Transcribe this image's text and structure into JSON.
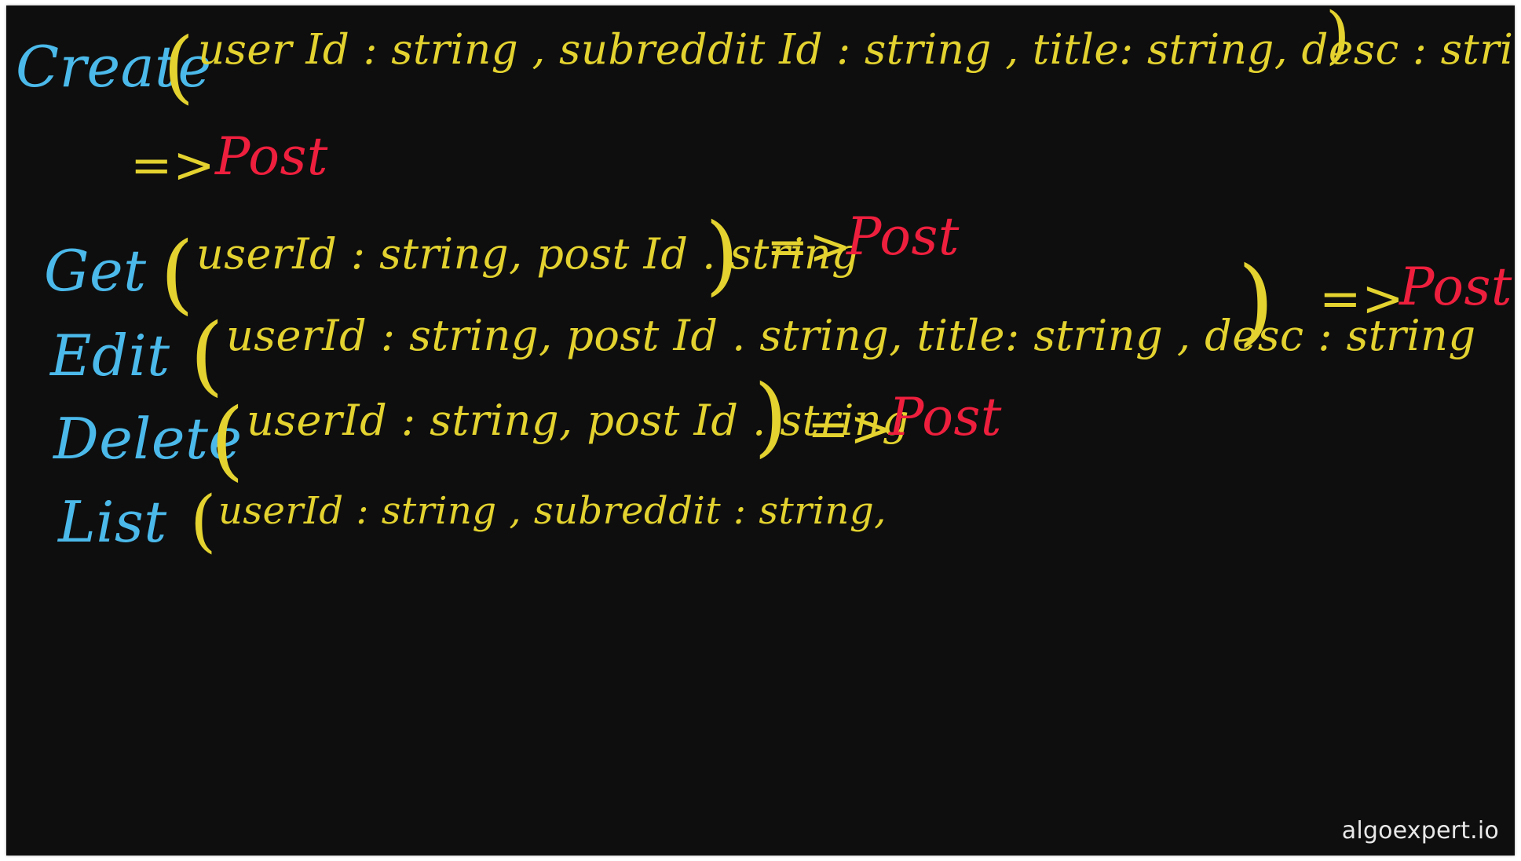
{
  "colors": {
    "background": "#0e0e0e",
    "keyword": "#4bb9ea",
    "args": "#e3d22f",
    "return": "#ee1f3d",
    "watermark": "#e8e8e8"
  },
  "lines": [
    {
      "keyword": "Create",
      "open": "(",
      "args": "user Id : string ,  subreddit Id : string , title: string, desc : string",
      "close": ")",
      "arrow": "=>",
      "returns": "Post"
    },
    {
      "keyword": "Get",
      "open": "(",
      "args": "userId : string, post Id . string",
      "close": ")",
      "arrow": "=>",
      "returns": "Post"
    },
    {
      "keyword": "Edit",
      "open": "(",
      "args": "userId : string, post Id . string, title: string ,  desc : string",
      "close": ")",
      "arrow": "=>",
      "returns": "Post"
    },
    {
      "keyword": "Delete",
      "open": "(",
      "args": "userId : string, post Id . string",
      "close": ")",
      "arrow": "=>",
      "returns": "Post"
    },
    {
      "keyword": "List",
      "open": "(",
      "args": "userId : string , subreddit : string,"
    }
  ],
  "watermark": "algoexpert.io"
}
